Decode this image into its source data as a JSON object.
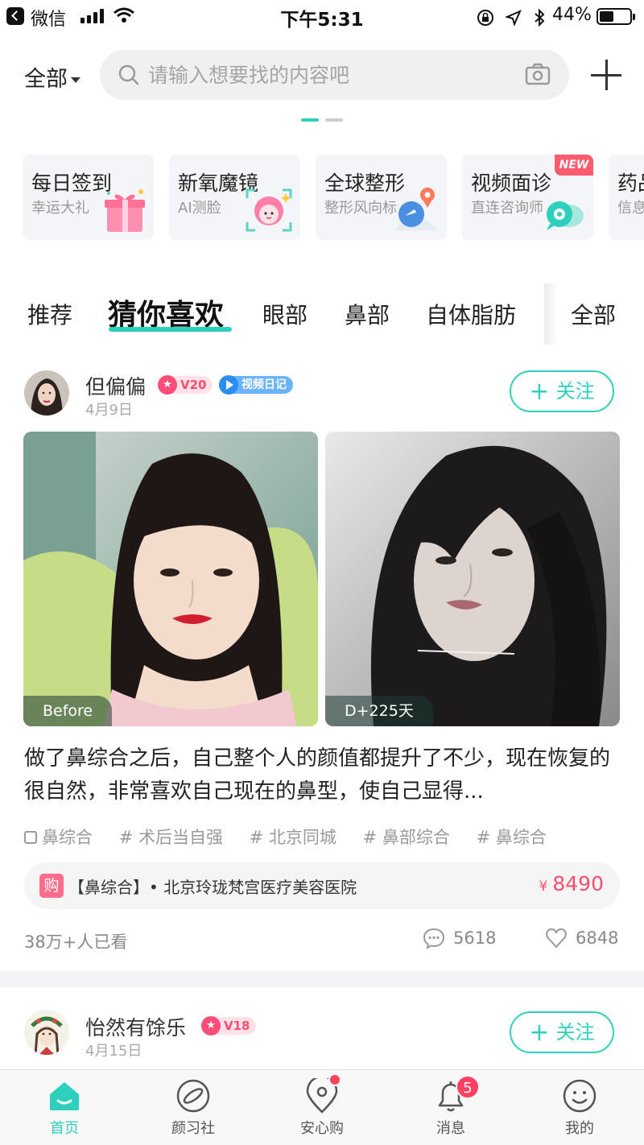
{
  "status_bar": {
    "app": "微信",
    "time": "下午5:31",
    "battery": "44%",
    "battery_level": 0.44
  },
  "search": {
    "filter_label": "全部",
    "placeholder": "请输入想要找的内容吧"
  },
  "quick_cards": [
    {
      "title": "每日签到",
      "subtitle": "幸运大礼",
      "icon": "gift-icon"
    },
    {
      "title": "新氧魔镜",
      "subtitle": "AI测脸",
      "icon": "face-scan-icon"
    },
    {
      "title": "全球整形",
      "subtitle": "整形风向标",
      "icon": "globe-pin-icon"
    },
    {
      "title": "视频面诊",
      "subtitle": "直连咨询师",
      "icon": "video-chat-icon",
      "badge": "NEW"
    },
    {
      "title": "药品",
      "subtitle": "信息",
      "icon": "pill-icon"
    }
  ],
  "tabs": {
    "items": [
      "推荐",
      "猜你喜欢",
      "眼部",
      "鼻部",
      "自体脂肪"
    ],
    "active": "猜你喜欢",
    "all_label": "全部"
  },
  "posts": [
    {
      "user": "但偏偏",
      "level": "V20",
      "video_badge": "视频日记",
      "date": "4月9日",
      "follow_label": "关注",
      "photo_before_label": "Before",
      "photo_after_label": "D+225天",
      "text": "做了鼻综合之后，自己整个人的颜值都提升了不少，现在恢复的很自然，非常喜欢自己现在的鼻型，使自己显得...",
      "tags": [
        "鼻综合",
        "# 术后当自强",
        "# 北京同城",
        "# 鼻部综合",
        "# 鼻综合"
      ],
      "product": {
        "buy_label": "购",
        "name": "【鼻综合】• 北京玲珑梵宫医疗美容医院",
        "currency": "¥",
        "price": "8490"
      },
      "views": "38万+人已看",
      "comments": "5618",
      "likes": "6848"
    },
    {
      "user": "怡然有馀乐",
      "level": "V18",
      "date": "4月15日",
      "follow_label": "关注"
    }
  ],
  "tabbar": {
    "items": [
      {
        "label": "首页",
        "icon": "home-icon",
        "active": true
      },
      {
        "label": "颜习社",
        "icon": "planet-icon"
      },
      {
        "label": "安心购",
        "icon": "location-pin-icon",
        "dot": true
      },
      {
        "label": "消息",
        "icon": "bell-icon",
        "badge": "5"
      },
      {
        "label": "我的",
        "icon": "smiley-icon"
      }
    ]
  },
  "colors": {
    "accent": "#2fcfbe",
    "price": "#ff4d6f",
    "badge_red": "#ff4060"
  }
}
